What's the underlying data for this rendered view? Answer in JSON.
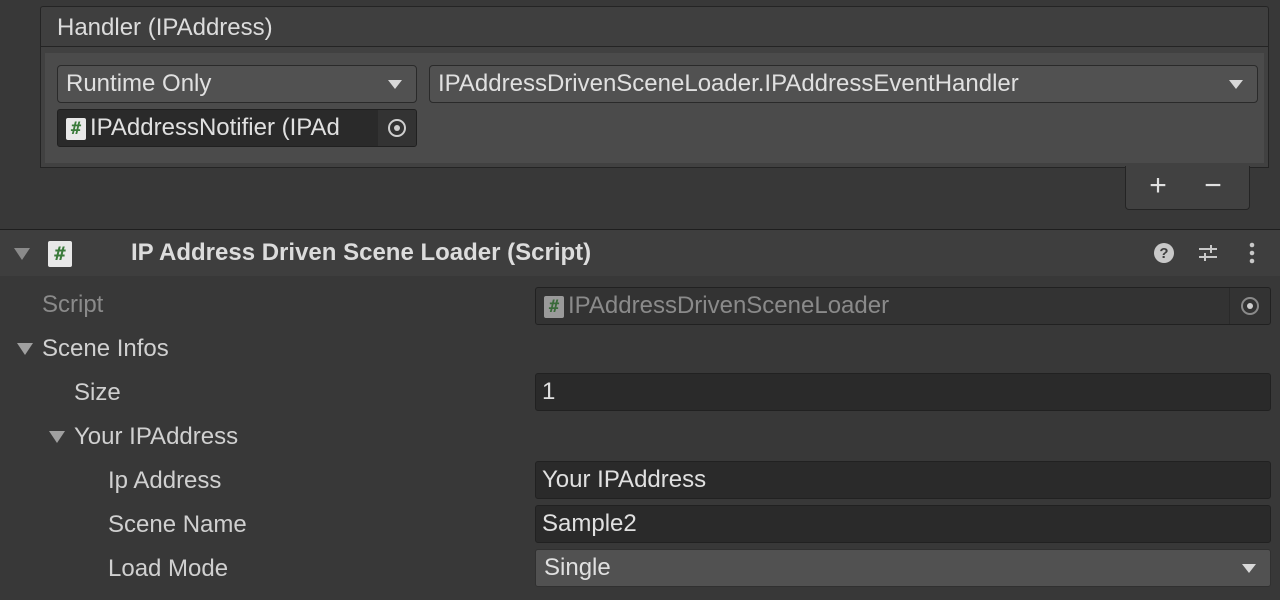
{
  "event": {
    "header_title": "Handler (IPAddress)",
    "runtime_dropdown": "Runtime Only",
    "function_dropdown": "IPAddressDrivenSceneLoader.IPAddressEventHandler",
    "target_object": "IPAddressNotifier (IPAd",
    "add_label": "+",
    "remove_label": "−"
  },
  "component": {
    "title": "IP Address Driven Scene Loader (Script)",
    "icons": [
      "script-icon",
      "help-icon",
      "preset-icon",
      "kebab-menu-icon"
    ]
  },
  "inspector": {
    "script_label": "Script",
    "script_value": "IPAddressDrivenSceneLoader",
    "scene_infos_label": "Scene Infos",
    "size_label": "Size",
    "size_value": "1",
    "element_label": "Your IPAddress",
    "ip_address_label": "Ip Address",
    "ip_address_value": "Your IPAddress",
    "scene_name_label": "Scene Name",
    "scene_name_value": "Sample2",
    "load_mode_label": "Load Mode",
    "load_mode_value": "Single"
  },
  "colors": {
    "background": "#383838",
    "field": "#2a2a2a",
    "dropdown": "#515151",
    "script_hash": "#3a7a3a"
  }
}
